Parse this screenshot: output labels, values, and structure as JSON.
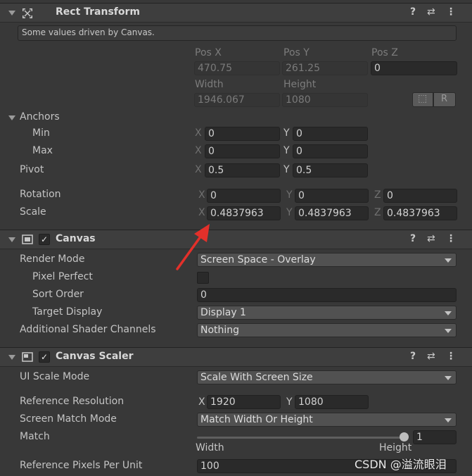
{
  "rect_transform": {
    "title": "Rect Transform",
    "info": "Some values driven by Canvas.",
    "pos_labels": [
      "Pos X",
      "Pos Y",
      "Pos Z"
    ],
    "pos_values": [
      "470.75",
      "261.25",
      "0"
    ],
    "size_labels": [
      "Width",
      "Height"
    ],
    "size_values": [
      "1946.067",
      "1080"
    ],
    "blueprint_btn": "⬚",
    "raw_btn": "R",
    "anchors_label": "Anchors",
    "min_label": "Min",
    "max_label": "Max",
    "min": {
      "x": "0",
      "y": "0"
    },
    "max": {
      "x": "0",
      "y": "0"
    },
    "pivot_label": "Pivot",
    "pivot": {
      "x": "0.5",
      "y": "0.5"
    },
    "rotation_label": "Rotation",
    "rotation": {
      "x": "0",
      "y": "0",
      "z": "0"
    },
    "scale_label": "Scale",
    "scale": {
      "x": "0.4837963",
      "y": "0.4837963",
      "z": "0.4837963"
    },
    "axis": {
      "x": "X",
      "y": "Y",
      "z": "Z"
    }
  },
  "canvas": {
    "title": "Canvas",
    "checked": "✓",
    "render_mode_label": "Render Mode",
    "render_mode": "Screen Space - Overlay",
    "pixel_perfect_label": "Pixel Perfect",
    "sort_order_label": "Sort Order",
    "sort_order": "0",
    "target_display_label": "Target Display",
    "target_display": "Display 1",
    "shader_channels_label": "Additional Shader Channels",
    "shader_channels": "Nothing"
  },
  "canvas_scaler": {
    "title": "Canvas Scaler",
    "checked": "✓",
    "ui_scale_mode_label": "UI Scale Mode",
    "ui_scale_mode": "Scale With Screen Size",
    "ref_res_label": "Reference Resolution",
    "ref_res": {
      "x": "1920",
      "y": "1080"
    },
    "match_mode_label": "Screen Match Mode",
    "match_mode": "Match Width Or Height",
    "match_label": "Match",
    "match_value": "1",
    "match_slider": 1,
    "width_label": "Width",
    "height_label": "Height",
    "ppu_label": "Reference Pixels Per Unit",
    "ppu": "100"
  },
  "header_icons": {
    "help": "?",
    "presets": "⇄",
    "menu": "⋮"
  },
  "watermark": "CSDN @溢流眼泪",
  "colors": {
    "bg": "#383838",
    "header": "#3e3e3e",
    "field": "#2a2a2a",
    "dropdown": "#515151",
    "arrow": "#e3302a"
  }
}
